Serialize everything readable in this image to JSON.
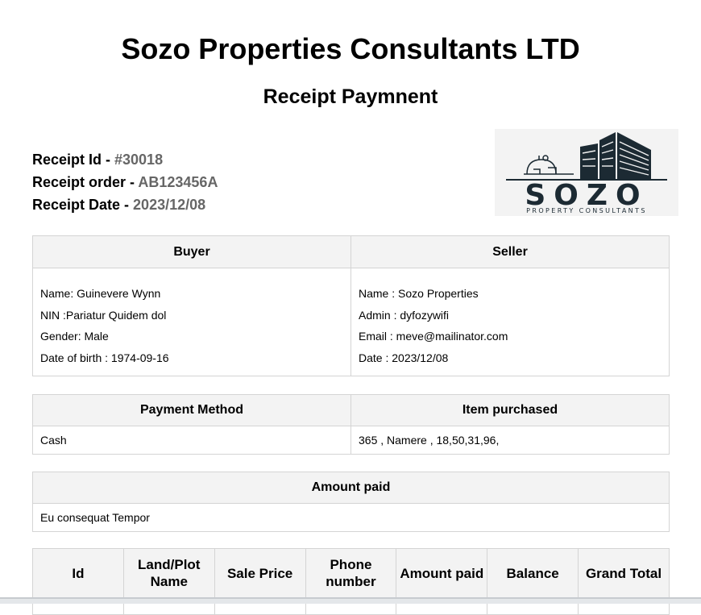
{
  "header": {
    "company": "Sozo Properties Consultants LTD",
    "title": "Receipt Paymnent"
  },
  "receipt": {
    "id_label": "Receipt Id - ",
    "id_value": "#30018",
    "order_label": "Receipt order - ",
    "order_value": "AB123456A",
    "date_label": "Receipt Date - ",
    "date_value": "2023/12/08"
  },
  "logo": {
    "wordmark": "SOZO",
    "tagline": "PROPERTY CONSULTANTS"
  },
  "parties": {
    "buyer_header": "Buyer",
    "seller_header": "Seller",
    "buyer": [
      "Name: Guinevere Wynn",
      "NIN :Pariatur Quidem dol",
      "Gender: Male",
      "Date of birth : 1974-09-16"
    ],
    "seller": [
      "Name : Sozo Properties",
      "Admin : dyfozywifi",
      "Email : meve@mailinator.com",
      "Date : 2023/12/08"
    ]
  },
  "payment": {
    "method_header": "Payment Method",
    "item_header": "Item purchased",
    "method_value": "Cash",
    "item_value": "365 , Namere , 18,50,31,96,"
  },
  "amount": {
    "header": "Amount paid",
    "value": "Eu consequat Tempor"
  },
  "items_table": {
    "columns": [
      "Id",
      "Land/Plot Name",
      "Sale Price",
      "Phone number",
      "Amount paid",
      "Balance",
      "Grand Total"
    ]
  }
}
